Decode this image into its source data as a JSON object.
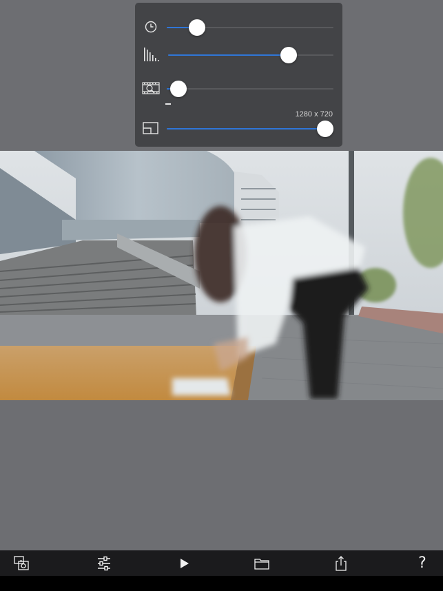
{
  "settings_panel": {
    "time_slider": {
      "icon": "clock-icon",
      "value": 0.18
    },
    "quality_slider": {
      "icon": "bar-levels-icon",
      "value": 0.73
    },
    "frame_slider": {
      "icon": "film-zoom-icon",
      "value": 0.07
    },
    "resolution_slider": {
      "icon": "resolution-icon",
      "value": 0.95,
      "value_label": "1280 x 720"
    }
  },
  "video": {
    "description_icon": "video-frame"
  },
  "toolbar": {
    "items": [
      {
        "name": "snapshot-button",
        "icon": "gallery-camera-icon"
      },
      {
        "name": "adjustments-button",
        "icon": "sliders-icon"
      },
      {
        "name": "play-button",
        "icon": "play-icon"
      },
      {
        "name": "open-folder-button",
        "icon": "folder-icon"
      },
      {
        "name": "share-button",
        "icon": "share-icon"
      },
      {
        "name": "help-button",
        "icon": "question-icon",
        "label": "?"
      }
    ]
  },
  "colors": {
    "accent": "#2f76d8",
    "panel": "#434447",
    "background": "#6d6e72",
    "toolbar": "#1b1b1d"
  }
}
